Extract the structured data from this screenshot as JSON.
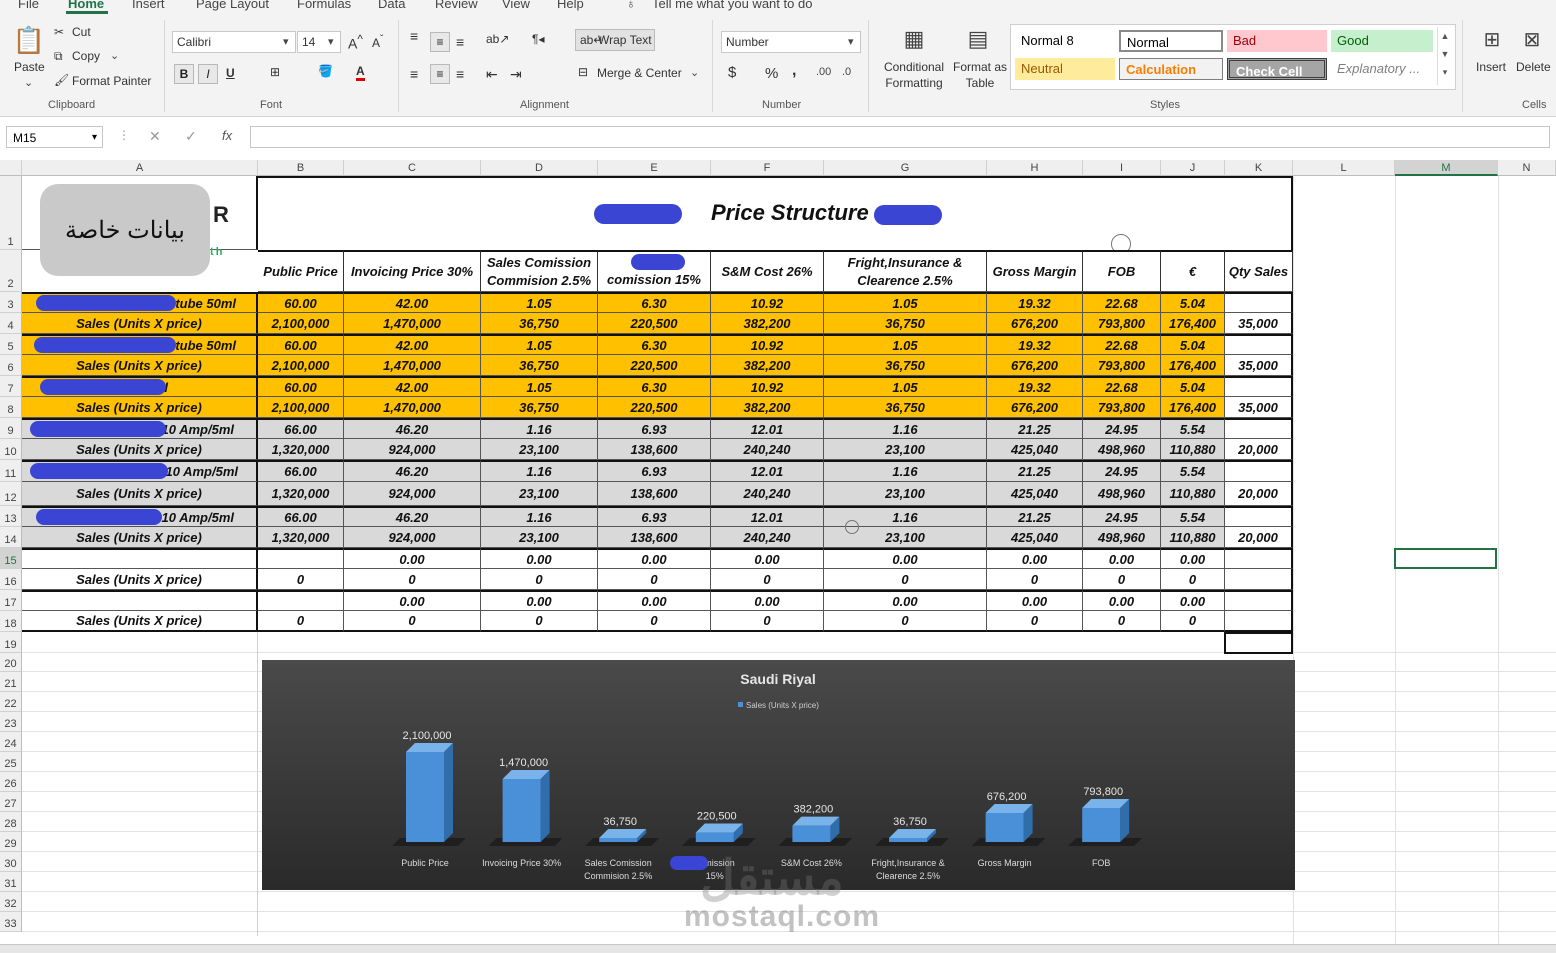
{
  "menu": [
    "File",
    "Home",
    "Insert",
    "Page Layout",
    "Formulas",
    "Data",
    "Review",
    "View",
    "Help"
  ],
  "tell_me": "Tell me what you want to do",
  "ribbon": {
    "clipboard": {
      "paste": "Paste",
      "cut": "Cut",
      "copy": "Copy",
      "format_painter": "Format Painter",
      "label": "Clipboard"
    },
    "font": {
      "name": "Calibri",
      "size": "14",
      "bold": "B",
      "italic": "I",
      "underline": "U",
      "label": "Font"
    },
    "alignment": {
      "wrap_text": "Wrap Text",
      "merge_center": "Merge & Center",
      "label": "Alignment"
    },
    "number": {
      "format": "Number",
      "currency": "$",
      "percent": "%",
      "comma": ",",
      "inc_dec": ".00",
      "dec_dec": ".0",
      "label": "Number"
    },
    "styles": {
      "conditional": "Conditional Formatting",
      "format_as_table": "Format as Table",
      "label": "Styles",
      "cells": [
        "Normal 8",
        "Normal",
        "Bad",
        "Good",
        "Neutral",
        "Calculation",
        "Check Cell",
        "Explanatory ..."
      ]
    },
    "cells": {
      "insert": "Insert",
      "delete": "Delete",
      "label": "Cells"
    }
  },
  "formula_bar": {
    "name_box": "M15",
    "fx": "fx",
    "value": ""
  },
  "columns": [
    "A",
    "B",
    "C",
    "D",
    "E",
    "F",
    "G",
    "H",
    "I",
    "J",
    "K",
    "L",
    "M",
    "N"
  ],
  "rows": [
    "1",
    "2",
    "3",
    "4",
    "5",
    "6",
    "7",
    "8",
    "9",
    "10",
    "11",
    "12",
    "13",
    "14",
    "15",
    "16",
    "17",
    "18",
    "19",
    "20",
    "21",
    "22",
    "23",
    "24",
    "25",
    "26",
    "27",
    "28",
    "29",
    "30",
    "31",
    "32",
    "33"
  ],
  "sheet": {
    "badge": "بيانات خاصة",
    "logo_fragment": "R",
    "logo_sub": "lth",
    "title": "Price Structure",
    "headers": [
      "Public Price",
      "Invoicing Price 30%",
      "Sales Comission Commision 2.5%",
      "comission 15%",
      "S&M Cost 26%",
      "Fright,Insurance & Clearence 2.5%",
      "Gross Margin",
      "FOB",
      "€",
      "Qty Sales"
    ],
    "rows": [
      {
        "label": "tube 50ml",
        "style": "orange",
        "values": [
          "60.00",
          "42.00",
          "1.05",
          "6.30",
          "10.92",
          "1.05",
          "19.32",
          "22.68",
          "5.04",
          ""
        ]
      },
      {
        "label": "Sales (Units X price)",
        "style": "orange",
        "values": [
          "2,100,000",
          "1,470,000",
          "36,750",
          "220,500",
          "382,200",
          "36,750",
          "676,200",
          "793,800",
          "176,400",
          "35,000"
        ]
      },
      {
        "label": "tube 50ml",
        "style": "orange",
        "values": [
          "60.00",
          "42.00",
          "1.05",
          "6.30",
          "10.92",
          "1.05",
          "19.32",
          "22.68",
          "5.04",
          ""
        ]
      },
      {
        "label": "Sales (Units X price)",
        "style": "orange",
        "values": [
          "2,100,000",
          "1,470,000",
          "36,750",
          "220,500",
          "382,200",
          "36,750",
          "676,200",
          "793,800",
          "176,400",
          "35,000"
        ]
      },
      {
        "label": "tube 50ml",
        "style": "orange",
        "values": [
          "60.00",
          "42.00",
          "1.05",
          "6.30",
          "10.92",
          "1.05",
          "19.32",
          "22.68",
          "5.04",
          ""
        ]
      },
      {
        "label": "Sales (Units X price)",
        "style": "orange",
        "values": [
          "2,100,000",
          "1,470,000",
          "36,750",
          "220,500",
          "382,200",
          "36,750",
          "676,200",
          "793,800",
          "176,400",
          "35,000"
        ]
      },
      {
        "label": "10 Amp/5ml",
        "style": "gray",
        "values": [
          "66.00",
          "46.20",
          "1.16",
          "6.93",
          "12.01",
          "1.16",
          "21.25",
          "24.95",
          "5.54",
          ""
        ]
      },
      {
        "label": "Sales (Units X price)",
        "style": "gray",
        "values": [
          "1,320,000",
          "924,000",
          "23,100",
          "138,600",
          "240,240",
          "23,100",
          "425,040",
          "498,960",
          "110,880",
          "20,000"
        ]
      },
      {
        "label": "10 Amp/5ml",
        "style": "gray",
        "values": [
          "66.00",
          "46.20",
          "1.16",
          "6.93",
          "12.01",
          "1.16",
          "21.25",
          "24.95",
          "5.54",
          ""
        ]
      },
      {
        "label": "Sales (Units X price)",
        "style": "gray",
        "values": [
          "1,320,000",
          "924,000",
          "23,100",
          "138,600",
          "240,240",
          "23,100",
          "425,040",
          "498,960",
          "110,880",
          "20,000"
        ]
      },
      {
        "label": "10 Amp/5ml",
        "style": "gray",
        "values": [
          "66.00",
          "46.20",
          "1.16",
          "6.93",
          "12.01",
          "1.16",
          "21.25",
          "24.95",
          "5.54",
          ""
        ]
      },
      {
        "label": "Sales (Units X price)",
        "style": "gray",
        "values": [
          "1,320,000",
          "924,000",
          "23,100",
          "138,600",
          "240,240",
          "23,100",
          "425,040",
          "498,960",
          "110,880",
          "20,000"
        ]
      },
      {
        "label": "",
        "style": "white",
        "values": [
          "",
          "0.00",
          "0.00",
          "0.00",
          "0.00",
          "0.00",
          "0.00",
          "0.00",
          "0.00",
          ""
        ]
      },
      {
        "label": "Sales (Units X price)",
        "style": "white",
        "values": [
          "0",
          "0",
          "0",
          "0",
          "0",
          "0",
          "0",
          "0",
          "0",
          ""
        ]
      },
      {
        "label": "",
        "style": "white",
        "values": [
          "",
          "0.00",
          "0.00",
          "0.00",
          "0.00",
          "0.00",
          "0.00",
          "0.00",
          "0.00",
          ""
        ]
      },
      {
        "label": "Sales (Units X price)",
        "style": "white",
        "values": [
          "0",
          "0",
          "0",
          "0",
          "0",
          "0",
          "0",
          "0",
          "0",
          ""
        ]
      }
    ]
  },
  "chart_data": {
    "type": "bar",
    "title": "Saudi Riyal",
    "legend": "Sales (Units X price)",
    "legend_position": "top",
    "categories": [
      "Public Price",
      "Invoicing Price 30%",
      "Sales Comission Commision 2.5%",
      "comission 15%",
      "S&M Cost 26%",
      "Fright,Insurance & Clearence 2.5%",
      "Gross Margin",
      "FOB"
    ],
    "category_lines": [
      [
        "Public Price"
      ],
      [
        "Invoicing Price 30%"
      ],
      [
        "Sales Comission",
        "Commision 2.5%"
      ],
      [
        "comission",
        "15%"
      ],
      [
        "S&M Cost 26%"
      ],
      [
        "Fright,Insurance &",
        "Clearence 2.5%"
      ],
      [
        "Gross Margin"
      ],
      [
        "FOB"
      ]
    ],
    "values": [
      2100000,
      1470000,
      36750,
      220500,
      382200,
      36750,
      676200,
      793800
    ],
    "value_labels": [
      "2,100,000",
      "1,470,000",
      "36,750",
      "220,500",
      "382,200",
      "36,750",
      "676,200",
      "793,800"
    ],
    "bar_color": "#4a90d9",
    "ylim": [
      0,
      2100000
    ],
    "grid": false
  },
  "watermark": "mostaql.com",
  "watermark_ar": "مستقل"
}
